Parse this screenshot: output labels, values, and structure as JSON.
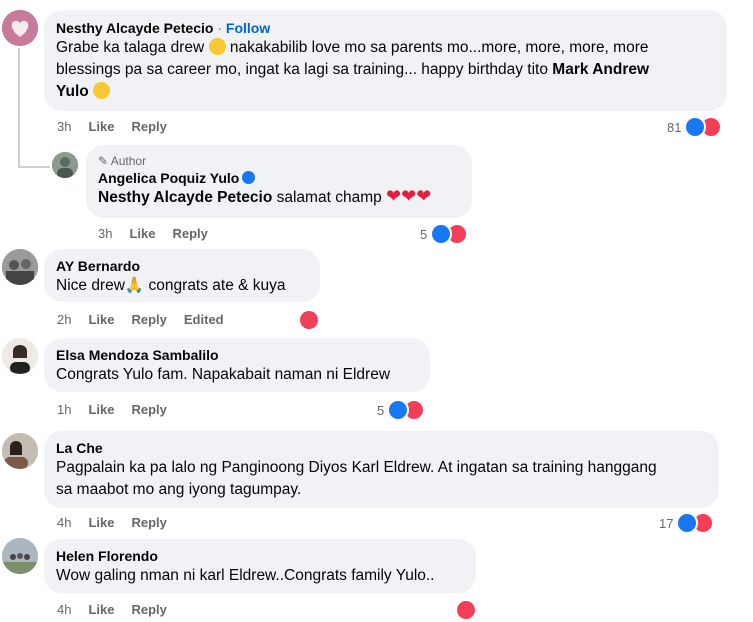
{
  "comments": [
    {
      "author": "Nesthy Alcayde Petecio",
      "follow_sep": " · ",
      "follow": "Follow",
      "text_1": "Grabe ka talaga drew ",
      "text_2": " nakakabilib love mo sa parents mo...more, more, more, more",
      "text_3": "blessings pa sa career mo, ingat ka lagi sa training... happy birthday tito ",
      "text_bold": "Mark Andrew",
      "text_bold_2": "Yulo",
      "time": "3h",
      "like": "Like",
      "reply": "Reply",
      "reaction_count": "81"
    },
    {
      "author_tag": "Author",
      "author": "Angelica Poquiz Yulo",
      "mention": "Nesthy Alcayde Petecio",
      "text": " salamat champ ",
      "hearts": "❤❤❤",
      "time": "3h",
      "like": "Like",
      "reply": "Reply",
      "reaction_count": "5"
    },
    {
      "author": "AY Bernardo",
      "text_1": "Nice drew",
      "text_2": " congrats ate & kuya",
      "time": "2h",
      "like": "Like",
      "reply": "Reply",
      "edited": "Edited"
    },
    {
      "author": "Elsa Mendoza Sambalilo",
      "text": "Congrats Yulo fam. Napakabait naman ni Eldrew",
      "time": "1h",
      "like": "Like",
      "reply": "Reply",
      "reaction_count": "5"
    },
    {
      "author": "La Che",
      "text_1": "Pagpalain ka pa lalo ng Panginoong Diyos Karl Eldrew. At ingatan sa training hanggang",
      "text_2": "sa maabot mo ang iyong tagumpay.",
      "time": "4h",
      "like": "Like",
      "reply": "Reply",
      "reaction_count": "17"
    },
    {
      "author": "Helen Florendo",
      "text": "Wow galing nman ni karl Eldrew..Congrats family Yulo..",
      "time": "4h",
      "like": "Like",
      "reply": "Reply"
    }
  ],
  "colors": {
    "bubble": "#f0f2f5",
    "like": "#1877f2",
    "love": "#f33e58",
    "link": "#0064d1",
    "muted": "#65676b"
  }
}
